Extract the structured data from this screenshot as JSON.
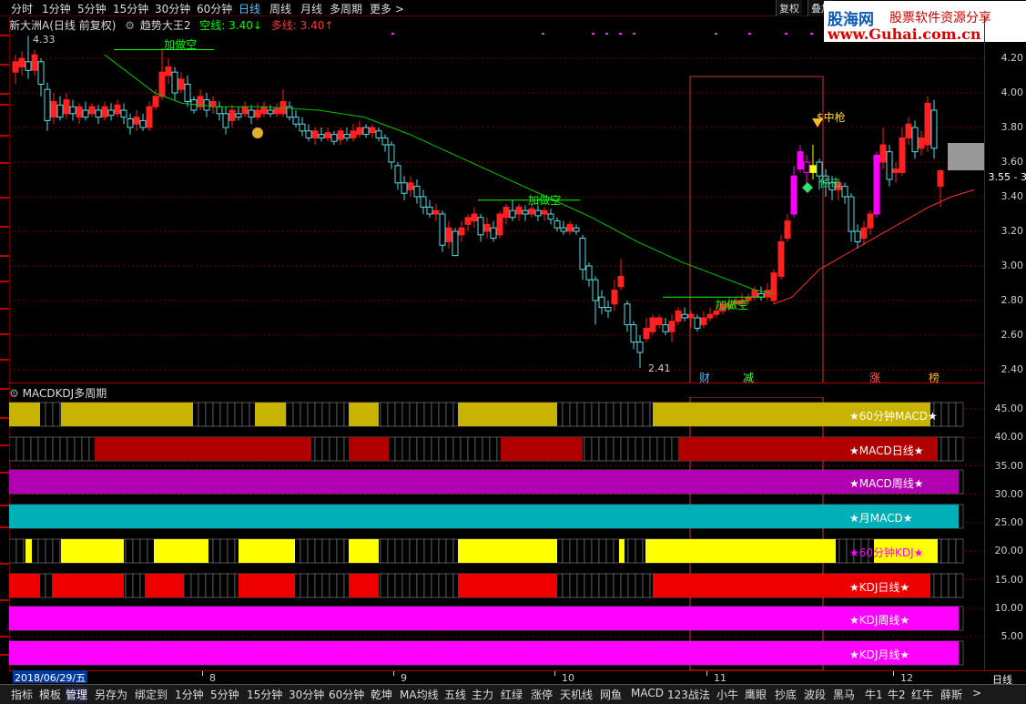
{
  "topbar": {
    "timeframes": [
      "分时",
      "1分钟",
      "5分钟",
      "15分钟",
      "30分钟",
      "60分钟",
      "日线",
      "周线",
      "月线",
      "多周期",
      "更多 >"
    ],
    "active": "日线",
    "right_buttons": [
      "复权",
      "叠加"
    ]
  },
  "logo": {
    "line1": "股海网",
    "line2": "股票软件资源分享",
    "line3": "www.Guhai.com.cn"
  },
  "info": {
    "stock": "新大洲A",
    "mode": "(日线 前复权)",
    "indicator": "趋势大王2",
    "short_label": "空线:",
    "short_value": "3.40",
    "long_label": "多线:",
    "long_value": "3.40"
  },
  "price_axis": [
    "4.20",
    "4.00",
    "3.80",
    "3.60",
    "3.40",
    "3.20",
    "3.00",
    "2.80",
    "2.60",
    "2.40"
  ],
  "annotations": {
    "high": "4.33",
    "low": "2.41",
    "add_short": "加做空",
    "zhongqiang": "$中枪",
    "zhenji": "侦击",
    "price_tag": "3.55 - 3",
    "cai": "财",
    "jian": "减",
    "zhang": "涨",
    "bang": "榜"
  },
  "sub": {
    "title": "MACDKDJ多周期",
    "axis": [
      "45.00",
      "40.00",
      "35.00",
      "30.00",
      "25.00",
      "20.00",
      "15.00",
      "10.00",
      "5.00"
    ],
    "rows": [
      {
        "label": "★60分钟MACD★",
        "color": "#c8b400",
        "labelcolor": "#fff",
        "star": "#fff"
      },
      {
        "label": "★MACD日线★",
        "color": "#b00000",
        "labelcolor": "#fff",
        "star": "#ff0"
      },
      {
        "label": "★MACD周线★",
        "color": "#b000b0",
        "labelcolor": "#fff",
        "star": "#ff0"
      },
      {
        "label": "★月MACD★",
        "color": "#00b0b8",
        "labelcolor": "#fff",
        "star": "#fff"
      },
      {
        "label": "★60分钟KDJ★",
        "color": "#ffff00",
        "labelcolor": "#f0f",
        "star": "#f0f"
      },
      {
        "label": "★KDJ日线★",
        "color": "#ee0000",
        "labelcolor": "#fff",
        "star": "#fff"
      },
      {
        "label": "★KDJ周线★",
        "color": "#ff00ff",
        "labelcolor": "#fff",
        "star": "#fff"
      },
      {
        "label": "★KDJ月线★",
        "color": "#ff00ff",
        "labelcolor": "#fff",
        "star": "#fff"
      }
    ]
  },
  "dateaxis": {
    "current": "2018/06/29/五",
    "months": [
      "8",
      "9",
      "10",
      "11",
      "12"
    ],
    "right": "日线"
  },
  "tabs": [
    "指标",
    "模板",
    "管理",
    "另存为",
    "绑定到",
    "1分钟",
    "5分钟",
    "15分钟",
    "30分钟",
    "60分钟",
    "乾坤",
    "MA均线",
    "五线",
    "主力",
    "红绿",
    "涨停",
    "天机线",
    "网鱼",
    "MACD",
    "123战法",
    "小牛",
    "鹰眼",
    "抄底",
    "波段",
    "黑马",
    "牛1",
    "牛2",
    "红牛",
    "薛斯"
  ],
  "active_tab": "管理",
  "colors": {
    "up": "#ff2020",
    "down": "#55dde8",
    "grid": "#7a0000",
    "green": "#00c800",
    "short_line": "#00ff00",
    "long_line": "#ff3030"
  }
}
